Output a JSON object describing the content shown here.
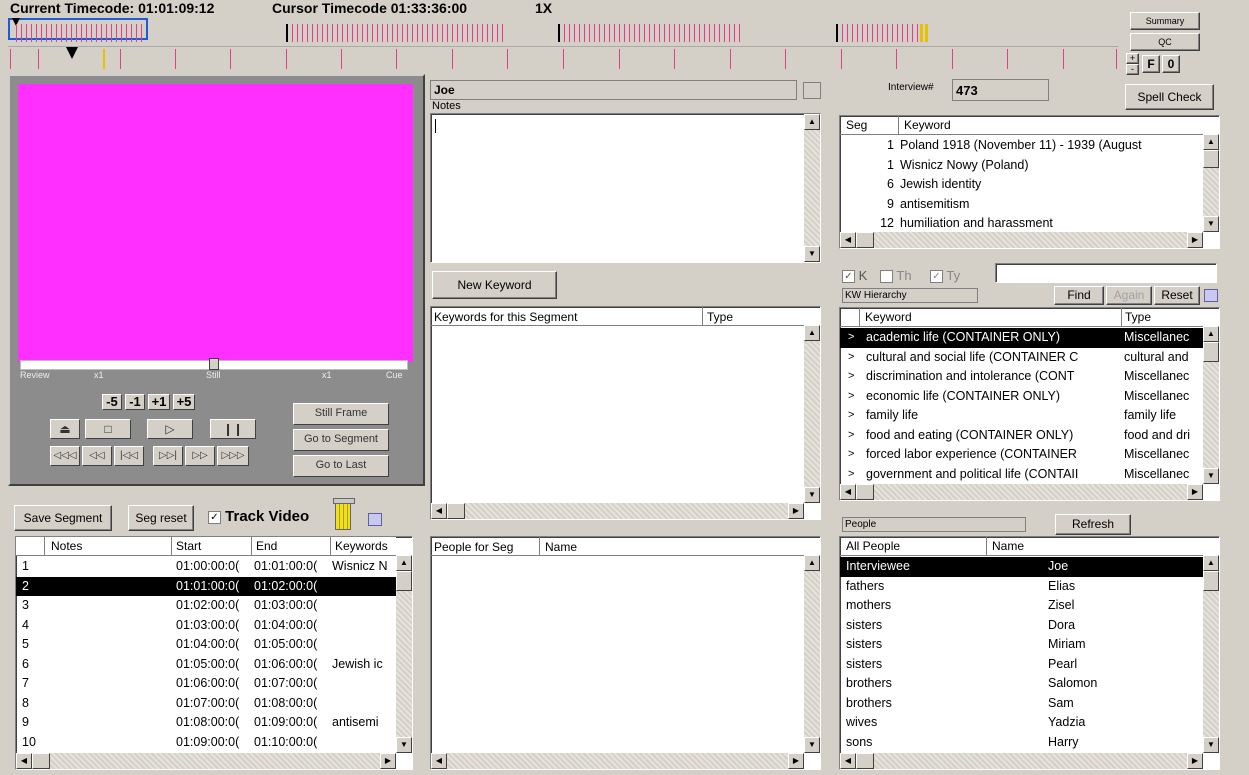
{
  "header": {
    "current_tc_label": "Current Timecode: 01:01:09:12",
    "cursor_tc_label": "Cursor Timecode  01:33:36:00",
    "speed": "1X"
  },
  "topbuttons": {
    "summary": "Summary",
    "qc": "QC",
    "plus": "+",
    "minus": "-",
    "f": "F",
    "o": "0"
  },
  "player": {
    "review": "Review",
    "x1_left": "x1",
    "still": "Still",
    "x1_right": "x1",
    "cue": "Cue",
    "step": [
      "-5",
      "-1",
      "+1",
      "+5"
    ],
    "still_frame": "Still Frame",
    "go_to_segment": "Go to Segment",
    "go_to_last": "Go to Last",
    "screen_color": "#ff30ff"
  },
  "segments": {
    "save_segment": "Save Segment",
    "seg_reset": "Seg reset",
    "track_video": "Track Video",
    "columns": [
      "Notes",
      "Start",
      "End",
      "Keywords"
    ],
    "rows": [
      {
        "n": "1",
        "start": "01:00:00:0(",
        "end": "01:01:00:0(",
        "kw": "Wisnicz N"
      },
      {
        "n": "2",
        "start": "01:01:00:0(",
        "end": "01:02:00:0(",
        "kw": ""
      },
      {
        "n": "3",
        "start": "01:02:00:0(",
        "end": "01:03:00:0(",
        "kw": ""
      },
      {
        "n": "4",
        "start": "01:03:00:0(",
        "end": "01:04:00:0(",
        "kw": ""
      },
      {
        "n": "5",
        "start": "01:04:00:0(",
        "end": "01:05:00:0(",
        "kw": ""
      },
      {
        "n": "6",
        "start": "01:05:00:0(",
        "end": "01:06:00:0(",
        "kw": "Jewish ic"
      },
      {
        "n": "7",
        "start": "01:06:00:0(",
        "end": "01:07:00:0(",
        "kw": ""
      },
      {
        "n": "8",
        "start": "01:07:00:0(",
        "end": "01:08:00:0(",
        "kw": ""
      },
      {
        "n": "9",
        "start": "01:08:00:0(",
        "end": "01:09:00:0(",
        "kw": "antisemi"
      },
      {
        "n": "10",
        "start": "01:09:00:0(",
        "end": "01:10:00:0(",
        "kw": ""
      }
    ],
    "selected_index": 1
  },
  "middle": {
    "name": "Joe",
    "notes_label": "Notes",
    "new_keyword": "New Keyword",
    "kw_col1": "Keywords for this Segment",
    "kw_col2": "Type",
    "people_col1": "People for Seg",
    "people_col2": "Name"
  },
  "right": {
    "interview_label": "Interview#",
    "interview_num": "473",
    "spell_check": "Spell Check",
    "seg_col": "Seg",
    "keyword_col": "Keyword",
    "seg_keywords": [
      {
        "seg": "1",
        "kw": "Poland 1918 (November 11) - 1939 (August"
      },
      {
        "seg": "1",
        "kw": "Wisnicz Nowy (Poland)"
      },
      {
        "seg": "6",
        "kw": "Jewish identity"
      },
      {
        "seg": "9",
        "kw": "antisemitism"
      },
      {
        "seg": "12",
        "kw": "humiliation and harassment"
      }
    ],
    "filter_k": "K",
    "filter_th": "Th",
    "filter_ty": "Ty",
    "kw_hierarchy": "KW Hierarchy",
    "find": "Find",
    "again": "Again",
    "reset": "Reset",
    "hier_col1": "Keyword",
    "hier_col2": "Type",
    "hierarchy": [
      {
        "kw": "academic life (CONTAINER ONLY)",
        "type": "Miscellanec"
      },
      {
        "kw": "cultural and social life (CONTAINER C",
        "type": "cultural and"
      },
      {
        "kw": "discrimination and intolerance (CONT",
        "type": "Miscellanec"
      },
      {
        "kw": "economic life (CONTAINER ONLY)",
        "type": "Miscellanec"
      },
      {
        "kw": "family life",
        "type": "family life"
      },
      {
        "kw": "food and eating (CONTAINER ONLY)",
        "type": "food and dri"
      },
      {
        "kw": "forced labor experience (CONTAINER",
        "type": "Miscellanec"
      },
      {
        "kw": "government and political life (CONTAII",
        "type": "Miscellanec"
      }
    ],
    "people_label": "People",
    "refresh": "Refresh",
    "people_col1": "All People",
    "people_col2": "Name",
    "people": [
      {
        "rel": "Interviewee",
        "name": "Joe"
      },
      {
        "rel": "fathers",
        "name": "Elias"
      },
      {
        "rel": "mothers",
        "name": "Zisel"
      },
      {
        "rel": "sisters",
        "name": "Dora"
      },
      {
        "rel": "sisters",
        "name": "Miriam"
      },
      {
        "rel": "sisters",
        "name": "Pearl"
      },
      {
        "rel": "brothers",
        "name": "Salomon"
      },
      {
        "rel": "brothers",
        "name": "Sam"
      },
      {
        "rel": "wives",
        "name": "Yadzia"
      },
      {
        "rel": "sons",
        "name": "Harry"
      }
    ]
  }
}
